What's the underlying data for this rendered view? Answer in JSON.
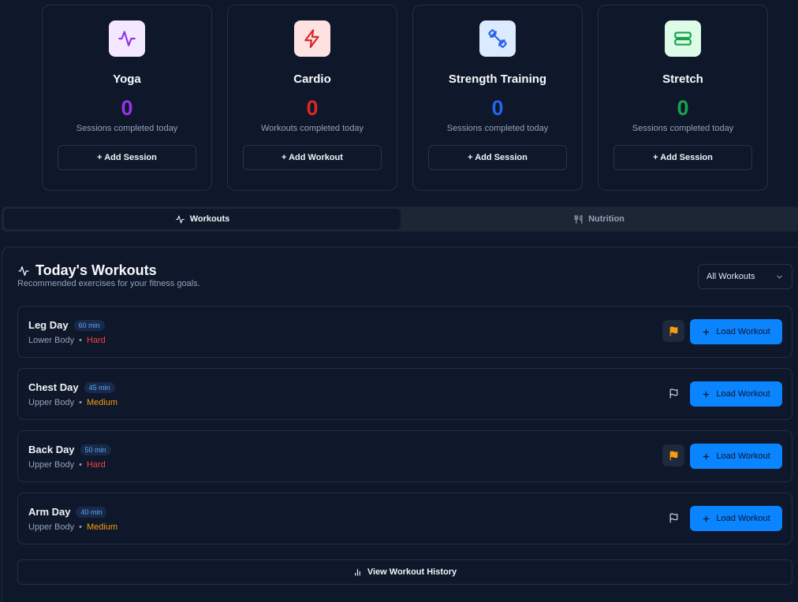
{
  "stats": [
    {
      "title": "Yoga",
      "count": "0",
      "subtitle": "Sessions completed today",
      "button": "+ Add Session",
      "icon": "activity-icon",
      "color": "#9333ea",
      "bg": "#f3e8ff"
    },
    {
      "title": "Cardio",
      "count": "0",
      "subtitle": "Workouts completed today",
      "button": "+ Add Workout",
      "icon": "zap-icon",
      "color": "#dc2626",
      "bg": "#fee2e2"
    },
    {
      "title": "Strength Training",
      "count": "0",
      "subtitle": "Sessions completed today",
      "button": "+ Add Session",
      "icon": "dumbbell-icon",
      "color": "#2563eb",
      "bg": "#dbeafe"
    },
    {
      "title": "Stretch",
      "count": "0",
      "subtitle": "Sessions completed today",
      "button": "+ Add Session",
      "icon": "stretch-icon",
      "color": "#16a34a",
      "bg": "#dcfce7"
    }
  ],
  "tabs": {
    "workouts": "Workouts",
    "nutrition": "Nutrition",
    "active": "workouts"
  },
  "panel": {
    "title": "Today's Workouts",
    "subtitle": "Recommended exercises for your fitness goals.",
    "filter": "All Workouts",
    "load_label": "Load Workout",
    "history_label": "View Workout History"
  },
  "workouts": [
    {
      "name": "Leg Day",
      "duration": "60 min",
      "area": "Lower Body",
      "separator": "•",
      "difficulty": "Hard",
      "flagged": true
    },
    {
      "name": "Chest Day",
      "duration": "45 min",
      "area": "Upper Body",
      "separator": "•",
      "difficulty": "Medium",
      "flagged": false
    },
    {
      "name": "Back Day",
      "duration": "50 min",
      "area": "Upper Body",
      "separator": "•",
      "difficulty": "Hard",
      "flagged": true
    },
    {
      "name": "Arm Day",
      "duration": "40 min",
      "area": "Upper Body",
      "separator": "•",
      "difficulty": "Medium",
      "flagged": false
    }
  ],
  "colors": {
    "accent": "#0a84ff",
    "hard": "#ef4444",
    "medium": "#f59e0b",
    "flag_on": "#f59e0b"
  }
}
